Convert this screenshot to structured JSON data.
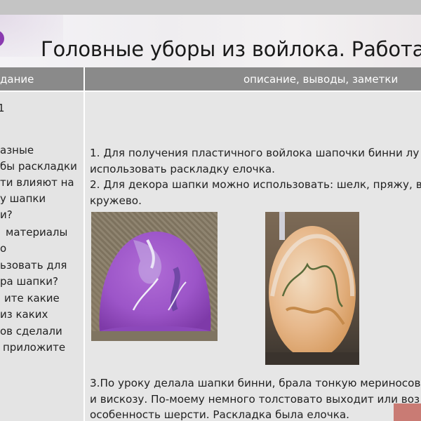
{
  "window": {
    "title": "Головные уборы из войлока. Работа н"
  },
  "table": {
    "header": {
      "left": "дание",
      "right": "описание, выводы, заметки"
    },
    "left_column": {
      "number": "1",
      "lines": [
        "азные",
        "бы раскладки",
        "ти влияют на",
        "у шапки",
        "и?",
        "материалы",
        "о",
        "ьзовать для",
        "ра шапки?",
        "ите какие",
        "из каких",
        "ов сделали",
        "приложите"
      ]
    },
    "right_column": {
      "paragraph1": [
        "1. Для получения пластичного войлока шапочки бинни лу",
        "использовать раскладку елочка.",
        "2. Для декора шапки можно использовать: шелк, пряжу, в",
        "кружево."
      ],
      "paragraph2": [
        "3.По уроку делала шапки бинни, брала тонкую мериносов",
        "и вискозу. По-моему немного толстовато выходит или воз",
        "особенность шерсти. Раскладка была елочка."
      ],
      "photos": [
        {
          "name": "purple-felt-hat-photo",
          "icon": "purple felt beanie with silk decor"
        },
        {
          "name": "orange-felt-hat-photo",
          "icon": "orange felt hat on form with yarn decor"
        }
      ]
    }
  },
  "colors": {
    "header_bar": "#8a8a8a",
    "background": "#e6e6e6",
    "accent_purple": "#8a3ab0"
  }
}
